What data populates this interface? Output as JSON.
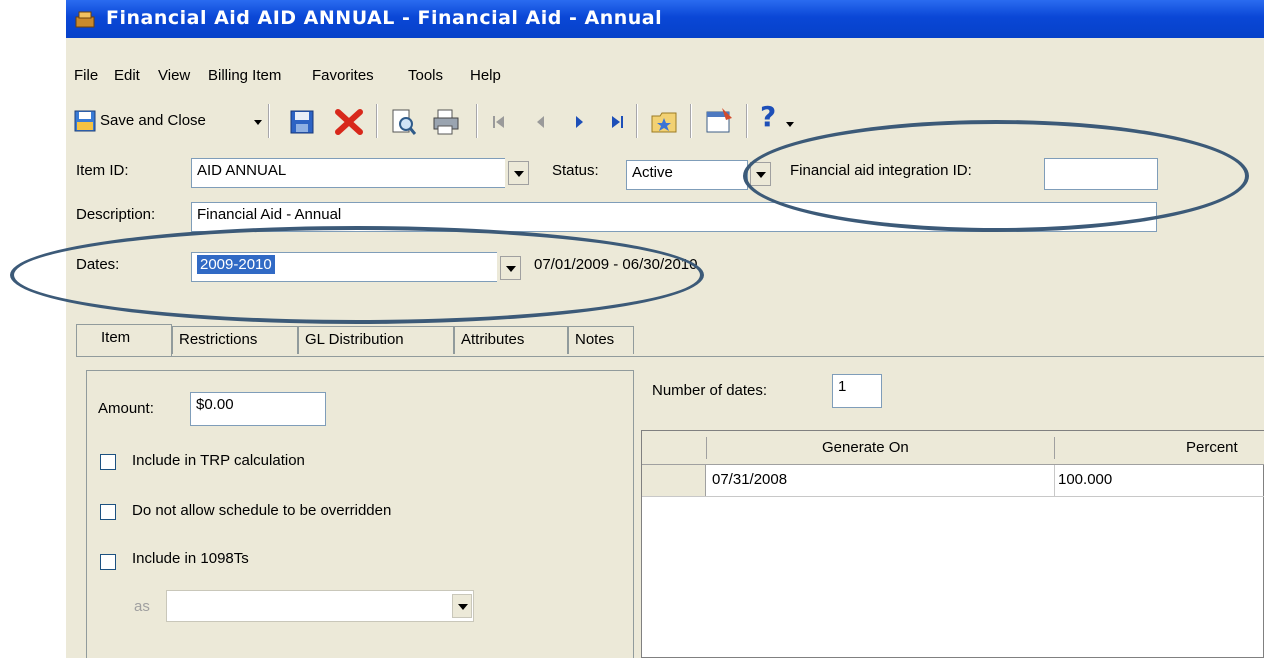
{
  "window": {
    "title": "Financial Aid AID ANNUAL - Financial Aid - Annual"
  },
  "menu": [
    "File",
    "Edit",
    "View",
    "Billing Item",
    "Favorites",
    "Tools",
    "Help"
  ],
  "toolbar": {
    "save_close_label": "Save and Close",
    "help_label": "?"
  },
  "form": {
    "item_id_label": "Item ID:",
    "item_id_value": "AID ANNUAL",
    "status_label": "Status:",
    "status_value": "Active",
    "fa_integration_label": "Financial aid integration ID:",
    "fa_integration_value": "",
    "description_label": "Description:",
    "description_value": "Financial Aid - Annual",
    "dates_label": "Dates:",
    "dates_value": "2009-2010",
    "dates_range": "07/01/2009 - 06/30/2010"
  },
  "tabs": [
    "Item",
    "Restrictions",
    "GL Distribution",
    "Attributes",
    "Notes"
  ],
  "item_tab": {
    "amount_label": "Amount:",
    "amount_value": "$0.00",
    "chk_trp_label": "Include in TRP calculation",
    "chk_override_label": "Do not allow schedule to be overridden",
    "chk_1098_label": "Include in 1098Ts",
    "as_label": "as",
    "as_value": ""
  },
  "schedule": {
    "num_dates_label": "Number of dates:",
    "num_dates_value": "1",
    "columns": [
      "Generate On",
      "Percent"
    ],
    "rows": [
      {
        "generate_on": "07/31/2008",
        "percent": "100.000"
      }
    ]
  },
  "colors": {
    "title_bar": "#0a47d6",
    "annotation_ellipse": "#3c5a78",
    "selection": "#316ac5"
  }
}
